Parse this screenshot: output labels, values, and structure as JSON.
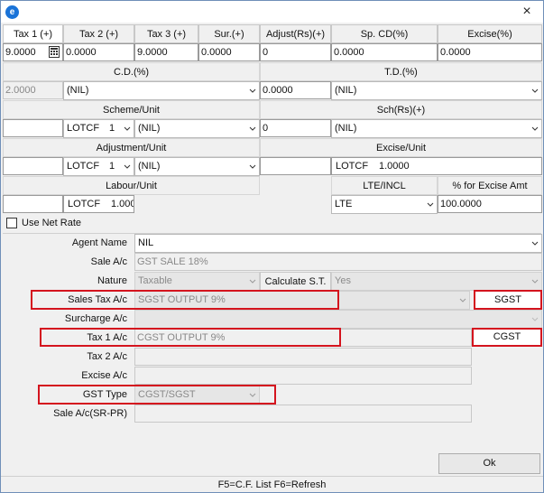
{
  "window": {
    "close_glyph": "×",
    "app_icon": "app-icon"
  },
  "header_row": {
    "tax1": "Tax 1 (+)",
    "tax2": "Tax 2 (+)",
    "tax3": "Tax 3 (+)",
    "sur": "Sur.(+)",
    "adjust": "Adjust(Rs)(+)",
    "spcd": "Sp. CD(%)",
    "excise": "Excise(%)"
  },
  "value_row": {
    "tax1": "9.0000",
    "tax2": "0.0000",
    "tax3": "9.0000",
    "sur": "0.0000",
    "adjust": "0",
    "spcd": "0.0000",
    "excise": "0.0000"
  },
  "cd": {
    "label": "C.D.(%)",
    "value": "2.0000",
    "select": "(NIL)"
  },
  "td": {
    "label": "T.D.(%)",
    "value": "0.0000",
    "select": "(NIL)"
  },
  "scheme": {
    "label": "Scheme/Unit",
    "unit": "LOTCF",
    "qty": "1",
    "select": "(NIL)"
  },
  "sch": {
    "label": "Sch(Rs)(+)",
    "value": "0",
    "select": "(NIL)"
  },
  "adjustment": {
    "label": "Adjustment/Unit",
    "unit": "LOTCF",
    "qty": "1",
    "select": "(NIL)"
  },
  "excise_unit": {
    "label": "Excise/Unit",
    "unit": "LOTCF",
    "value": "1.0000"
  },
  "labour": {
    "label": "Labour/Unit",
    "unit": "LOTCF",
    "value": "1.0000"
  },
  "lte": {
    "label": "LTE/INCL",
    "select": "LTE"
  },
  "pct_excise": {
    "label": "% for Excise Amt",
    "value": "100.0000"
  },
  "use_net_rate": {
    "label": "Use Net Rate"
  },
  "form": {
    "agent_name": {
      "label": "Agent Name",
      "value": "NIL"
    },
    "sale_ac": {
      "label": "Sale A/c",
      "value": "GST SALE 18%"
    },
    "nature": {
      "label": "Nature",
      "value": "Taxable"
    },
    "calc_st": {
      "label": "Calculate S.T.",
      "value": "Yes"
    },
    "sales_tax_ac": {
      "label": "Sales Tax A/c",
      "value": "SGST OUTPUT 9%"
    },
    "surcharge_ac": {
      "label": "Surcharge A/c",
      "value": ""
    },
    "tax1_ac": {
      "label": "Tax 1 A/c",
      "value": "CGST OUTPUT 9%"
    },
    "tax2_ac": {
      "label": "Tax 2 A/c",
      "value": ""
    },
    "excise_ac": {
      "label": "Excise A/c",
      "value": ""
    },
    "gst_type": {
      "label": "GST Type",
      "value": "CGST/SGST"
    },
    "sale_ac_srpr": {
      "label": "Sale A/c(SR-PR)",
      "value": ""
    }
  },
  "annotations": {
    "sgst": "SGST",
    "cgst": "CGST"
  },
  "ok_button": "Ok",
  "status": "F5=C.F. List   F6=Refresh",
  "colors": {
    "highlight": "#d4141e",
    "window_border": "#6f8fb8"
  }
}
